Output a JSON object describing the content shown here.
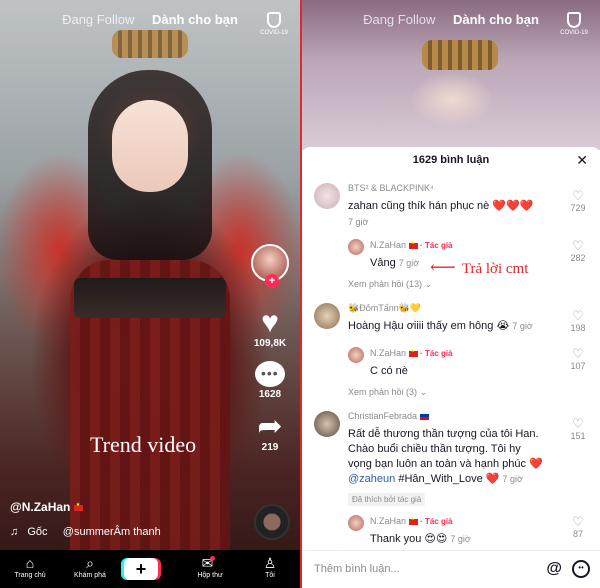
{
  "left": {
    "tabs": {
      "following": "Đang Follow",
      "for_you": "Dành cho bạn"
    },
    "covid_label": "COVID-19",
    "likes": "109,8K",
    "comments": "1628",
    "shares": "219",
    "overlay_caption": "Trend video",
    "author": "@N.ZaHan",
    "music": {
      "source": "Gốc",
      "track": "@summerÂm thanh"
    },
    "nav": {
      "home": "Trang chủ",
      "discover": "Khám phá",
      "inbox": "Hộp thư",
      "profile": "Tôi"
    }
  },
  "right": {
    "tabs": {
      "following": "Đang Follow",
      "for_you": "Dành cho bạn"
    },
    "covid_label": "COVID-19",
    "sheet_title": "1629 bình luận",
    "annotation": "Trả lời cmt",
    "comments": [
      {
        "user": "BTS² & BLACKPINK⁴",
        "text": "zahan cũng thík hán phục nè ❤️❤️❤️",
        "time": "7 giờ",
        "likes": "729",
        "replies": [
          {
            "user": "N.ZaHan",
            "tag": "· Tác giả",
            "text": "Vâng",
            "time": "7 giờ",
            "likes": "282"
          }
        ],
        "more": "Xem phản hồi (13)"
      },
      {
        "user": "🐝ĐỏmTấnn🐝💛",
        "text": "Hoàng Hậu ơiiii thấy em hông 😭",
        "time": "7 giờ",
        "likes": "198",
        "replies": [
          {
            "user": "N.ZaHan",
            "tag": "· Tác giả",
            "text": "C có nè",
            "time": "7 giờ",
            "likes": "107"
          }
        ],
        "more": "Xem phản hồi (3)"
      },
      {
        "user": "ChristianFebrada",
        "text_lines": [
          "Rất dễ thương thần tượng của tôi Han.",
          "Chào buổi chiều thần tượng. Tôi hy",
          "vọng bạn luôn an toàn và hạnh phúc ❤️"
        ],
        "mention": "@zaheun",
        "hashtag": "#Hân_With_Love ❤️",
        "time": "7 giờ",
        "likes": "151",
        "liked_by": "Đã thích bởi tác giả",
        "replies": [
          {
            "user": "N.ZaHan",
            "tag": "· Tác giả",
            "text": "Thank you 😍😍",
            "time": "7 giờ",
            "likes": "87"
          }
        ]
      }
    ],
    "input_placeholder": "Thêm bình luận..."
  }
}
